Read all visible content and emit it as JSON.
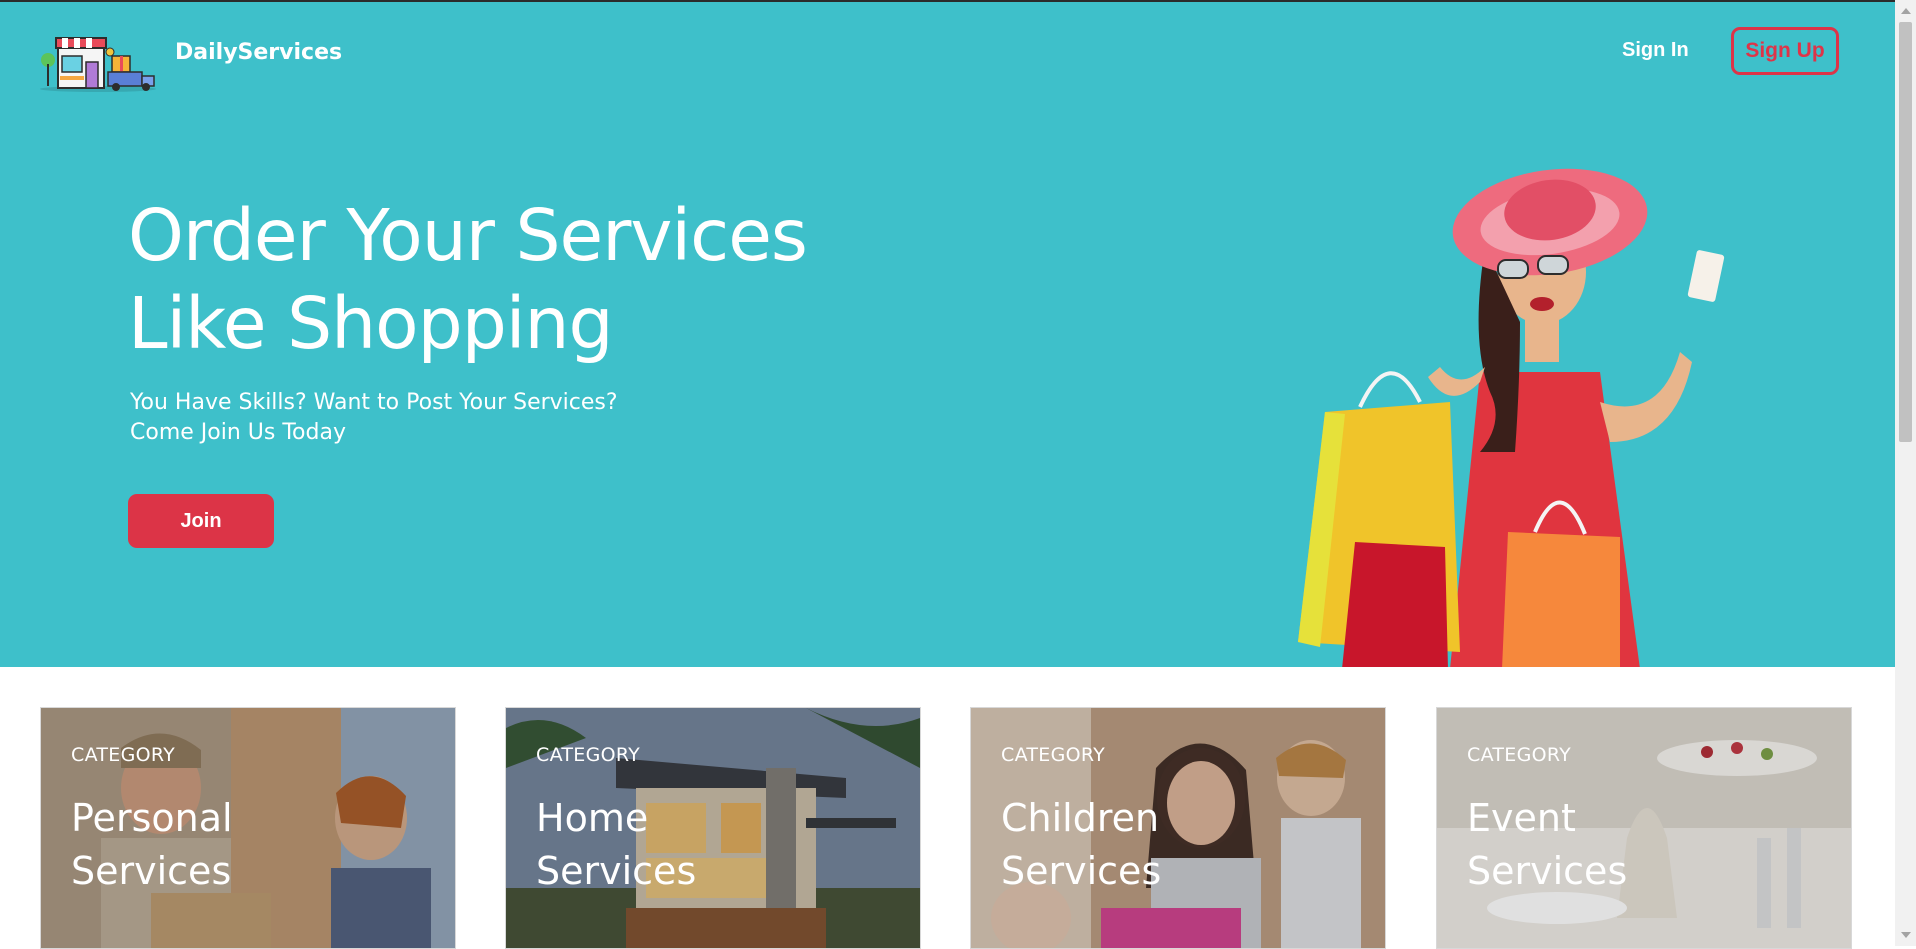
{
  "header": {
    "brand": "DailyServices",
    "logo_icon": "shop-truck-gift-icon",
    "sign_in": "Sign In",
    "sign_up": "Sign Up"
  },
  "hero": {
    "headline_line1": "Order Your Services",
    "headline_line2": "Like Shopping",
    "subtitle_line1": "You Have Skills? Want to Post Your Services?",
    "subtitle_line2": "Come Join Us Today",
    "join_button": "Join",
    "image": "woman-with-shopping-bags"
  },
  "categories": [
    {
      "kicker": "CATEGORY",
      "line1": "Personal",
      "line2": "Services",
      "image": "delivery-man-with-package"
    },
    {
      "kicker": "CATEGORY",
      "line1": "Home",
      "line2": "Services",
      "image": "modern-house-at-dusk"
    },
    {
      "kicker": "CATEGORY",
      "line1": "Children",
      "line2": "Services",
      "image": "mother-playing-with-children"
    },
    {
      "kicker": "CATEGORY",
      "line1": "Event",
      "line2": "Services",
      "image": "banquet-table-setting"
    }
  ],
  "colors": {
    "hero_bg": "#3ec0ca",
    "accent": "#dc3447",
    "text_light": "#ffffff"
  }
}
